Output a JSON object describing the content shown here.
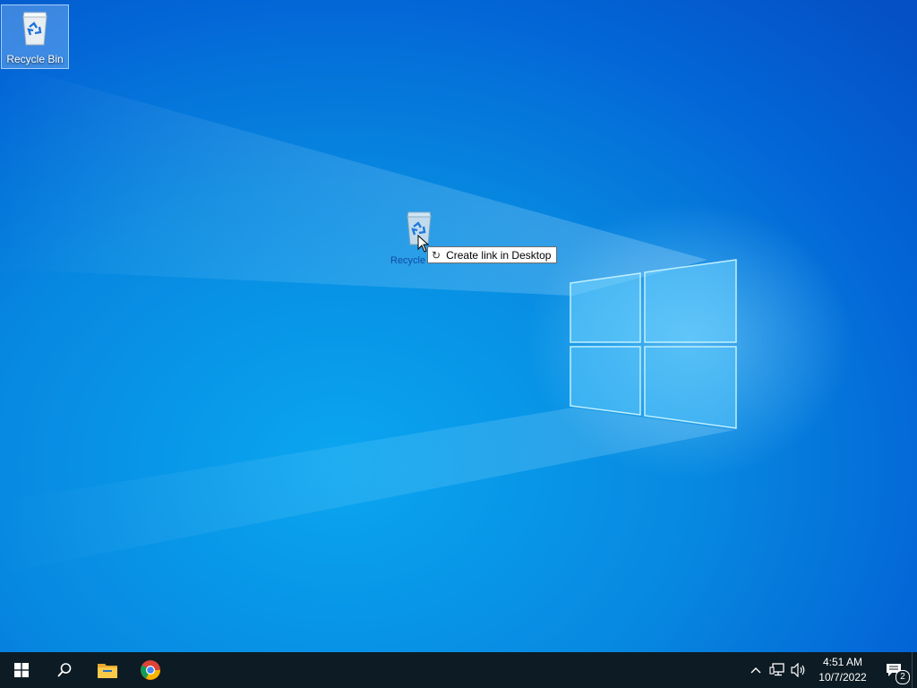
{
  "desktop": {
    "icons": [
      {
        "label": "Recycle Bin",
        "icon": "recycle-bin-icon",
        "selected": true
      }
    ],
    "drag": {
      "ghost_label": "Recycle",
      "tooltip_text": "Create link in Desktop",
      "tooltip_icon": "link-arrow-icon"
    }
  },
  "taskbar": {
    "start_icon": "windows-start-icon",
    "search_icon": "search-icon",
    "pinned": [
      {
        "name": "file-explorer",
        "icon": "folder-icon"
      },
      {
        "name": "chrome",
        "icon": "chrome-icon"
      }
    ],
    "tray": {
      "chevron_icon": "chevron-up-icon",
      "network_icon": "network-icon",
      "volume_icon": "volume-icon",
      "time": "4:51 AM",
      "date": "10/7/2022",
      "notification_count": "2"
    }
  },
  "colors": {
    "desktop_base": "#0788e0",
    "taskbar_bg": "#0d1b24",
    "tooltip_bg": "#ffffff"
  }
}
